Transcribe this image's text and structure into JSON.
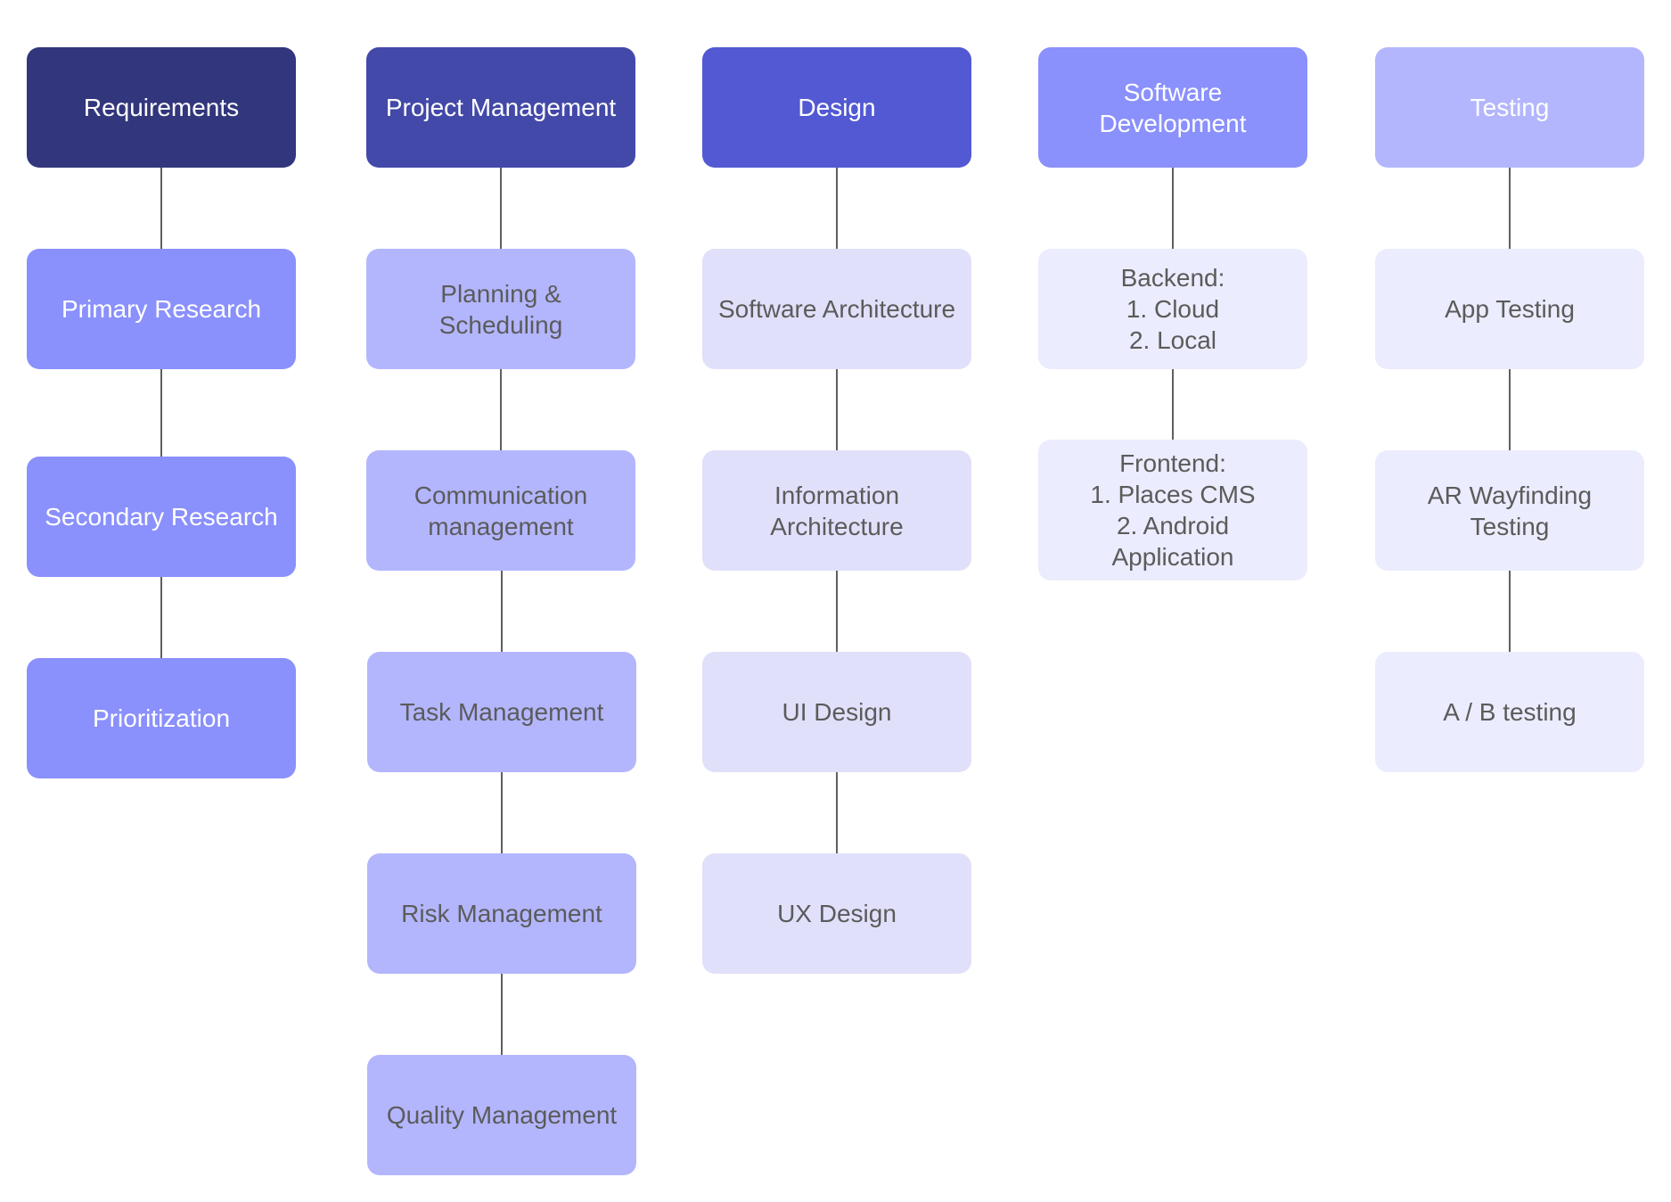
{
  "columns": [
    {
      "header": "Requirements",
      "items": [
        "Primary Research",
        "Secondary Research",
        "Prioritization"
      ]
    },
    {
      "header": "Project Management",
      "items": [
        "Planning &\nScheduling",
        "Communication\nmanagement",
        "Task Management",
        "Risk Management",
        "Quality Management"
      ]
    },
    {
      "header": "Design",
      "items": [
        "Software Architecture",
        "Information\nArchitecture",
        "UI Design",
        "UX Design"
      ]
    },
    {
      "header": "Software\nDevelopment",
      "items": [
        "Backend:\n1. Cloud\n2. Local",
        "Frontend:\n1. Places CMS\n2. Android\nApplication"
      ]
    },
    {
      "header": "Testing",
      "items": [
        "App Testing",
        "AR Wayfinding\nTesting",
        "A / B testing"
      ]
    }
  ],
  "colors": {
    "requirements_header": "#32367c",
    "project_management_header": "#4349a8",
    "design_header": "#5259d3",
    "software_development_header": "#8a90fc",
    "testing_header": "#b3b6fd",
    "requirements_items": "#8a90fc",
    "project_management_items": "#b3b6fd",
    "design_items": "#e0e0fb",
    "development_testing_items": "#ebecfd",
    "connector": "#5f5f5f"
  }
}
